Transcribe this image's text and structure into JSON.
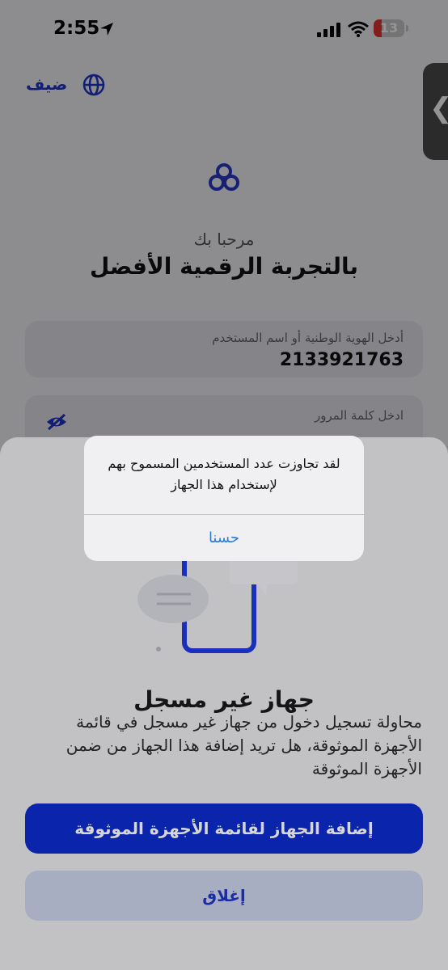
{
  "status_bar": {
    "time": "2:55",
    "battery": "13"
  },
  "header": {
    "guest_label": "ضيف"
  },
  "welcome": {
    "greeting": "مرحبا بك",
    "headline": "بالتجربة الرقمية الأفضل"
  },
  "form": {
    "id_label": "أدخل الهوية الوطنية أو اسم المستخدم",
    "id_value": "2133921763",
    "password_label": "ادخل كلمة المرور"
  },
  "sheet": {
    "title": "جهاز غير مسجل",
    "description": "محاولة تسجيل دخول من جهاز غير مسجل في قائمة الأجهزة الموثوقة، هل تريد إضافة هذا الجهاز من ضمن الأجهزة الموثوقة",
    "add_button": "إضافة الجهاز لقائمة الأجهزة الموثوقة",
    "close_button": "إغلاق"
  },
  "alert": {
    "message": "لقد تجاوزت عدد المستخدمين المسموح بهم لإستخدام هذا الجهاز",
    "ok_button": "حسنا"
  },
  "colors": {
    "accent": "#0c2bcc",
    "link": "#2b7ad6",
    "battery_low": "#e0342f"
  }
}
